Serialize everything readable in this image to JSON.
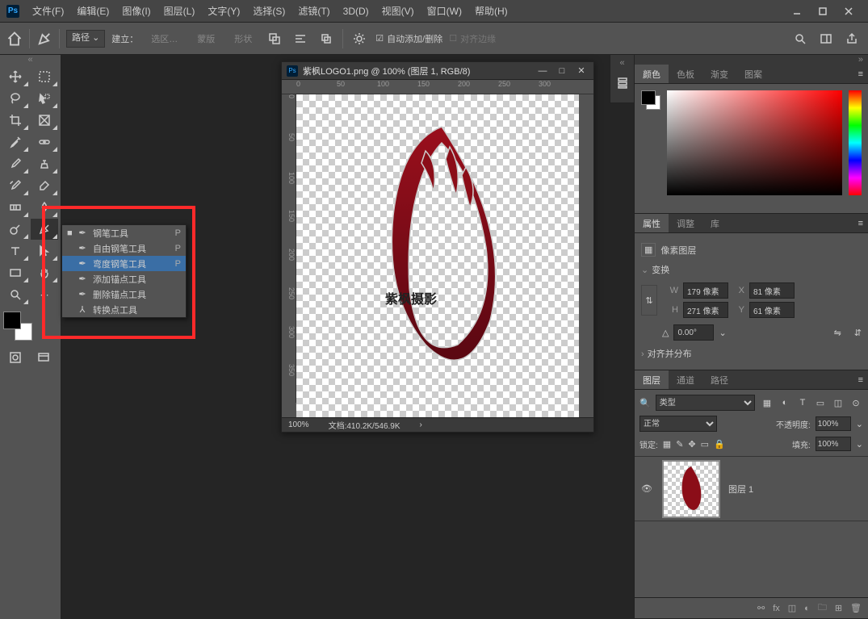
{
  "menubar": {
    "items": [
      "文件(F)",
      "编辑(E)",
      "图像(I)",
      "图层(L)",
      "文字(Y)",
      "选择(S)",
      "滤镜(T)",
      "3D(D)",
      "视图(V)",
      "窗口(W)",
      "帮助(H)"
    ]
  },
  "optbar": {
    "mode_label": "路径",
    "make_label": "建立：",
    "btn_selection": "选区…",
    "btn_mask": "蒙版",
    "btn_shape": "形状",
    "auto_add_delete": "自动添加/删除",
    "align_edges": "对齐边缘"
  },
  "doc": {
    "title": "紫枫LOGO1.png @ 100% (图层 1, RGB/8)",
    "zoom": "100%",
    "status": "文档:410.2K/546.9K",
    "ruler_h": [
      "0",
      "50",
      "100",
      "150",
      "200",
      "250",
      "300"
    ],
    "ruler_v": [
      "0",
      "50",
      "100",
      "150",
      "200",
      "250",
      "300",
      "350"
    ],
    "logo_text": "紫枫摄影"
  },
  "pen_flyout": {
    "items": [
      {
        "label": "钢笔工具",
        "shortcut": "P",
        "active": true
      },
      {
        "label": "自由钢笔工具",
        "shortcut": "P",
        "active": false
      },
      {
        "label": "弯度钢笔工具",
        "shortcut": "P",
        "active": false,
        "hover": true
      },
      {
        "label": "添加锚点工具",
        "shortcut": "",
        "active": false
      },
      {
        "label": "删除锚点工具",
        "shortcut": "",
        "active": false
      },
      {
        "label": "转换点工具",
        "shortcut": "",
        "active": false
      }
    ]
  },
  "panels": {
    "color": {
      "tabs": [
        "颜色",
        "色板",
        "渐变",
        "图案"
      ],
      "active": 0
    },
    "props": {
      "tabs": [
        "属性",
        "调整",
        "库"
      ],
      "active": 0,
      "type_label": "像素图层",
      "transform_label": "变换",
      "align_label": "对齐并分布",
      "W": "179 像素",
      "X": "81 像素",
      "H": "271 像素",
      "Y": "61 像素",
      "angle": "0.00°"
    },
    "layers": {
      "tabs": [
        "图层",
        "通道",
        "路径"
      ],
      "active": 0,
      "filter_label": "类型",
      "blend_mode": "正常",
      "opacity_label": "不透明度:",
      "opacity": "100%",
      "lock_label": "锁定:",
      "fill_label": "填充:",
      "fill": "100%",
      "layer1_name": "图层 1"
    }
  }
}
